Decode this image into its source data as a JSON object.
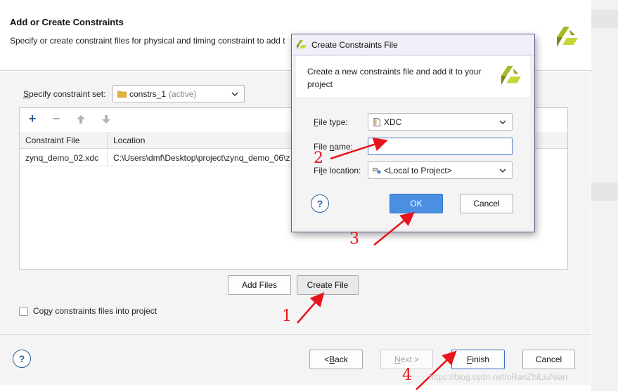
{
  "wizard": {
    "title": "Add or Create Constraints",
    "subtitle": "Specify or create constraint files for physical and timing constraint to add t",
    "constraint_set_label_u": "S",
    "constraint_set_label_rest": "pecify constraint set:",
    "constraint_set_value": "constrs_1",
    "constraint_set_suffix": "(active)",
    "table": {
      "columns": [
        "Constraint File",
        "Location"
      ],
      "rows": [
        {
          "file": "zynq_demo_02.xdc",
          "location": "C:\\Users\\dmf\\Desktop\\project\\zynq_demo_06\\z"
        }
      ]
    },
    "add_files_label": "Add Files",
    "create_file_label": "Create File",
    "copy_label_pre": "Co",
    "copy_label_u": "p",
    "copy_label_post": "y constraints files into project",
    "help_label": "?",
    "back_label_pre": "< ",
    "back_label_u": "B",
    "back_label_post": "ack",
    "next_label_u": "N",
    "next_label_post": "ext >",
    "finish_label_u": "F",
    "finish_label_post": "inish",
    "cancel_label": "Cancel",
    "accent_color": "#2d5d99"
  },
  "dialog": {
    "title": "Create Constraints File",
    "description": "Create a new constraints file and add it to your project",
    "file_type_label_u": "F",
    "file_type_label_rest": "ile type:",
    "file_type_value": "XDC",
    "file_name_label_pre": "File ",
    "file_name_label_u": "n",
    "file_name_label_post": "ame:",
    "file_name_value": "",
    "file_location_label_pre": "Fi",
    "file_location_label_u": "l",
    "file_location_label_post": "e location:",
    "file_location_value": "<Local to Project>",
    "ok_label": "OK",
    "cancel_label": "Cancel",
    "help_label": "?",
    "ok_color": "#4a8fe0"
  },
  "annotations": [
    "1",
    "2",
    "3",
    "4"
  ],
  "annotation_color": "#e8141c",
  "watermark": "https://blog.csdn.net/oRanZhiLiuNian",
  "icons": {
    "logo": "xilinx-logo-icon",
    "add": "plus-icon",
    "remove": "minus-icon",
    "up": "arrow-up-icon",
    "down": "arrow-down-icon",
    "folder": "folder-icon",
    "file": "file-icon",
    "location": "location-icon",
    "chevron": "chevron-down-icon"
  }
}
